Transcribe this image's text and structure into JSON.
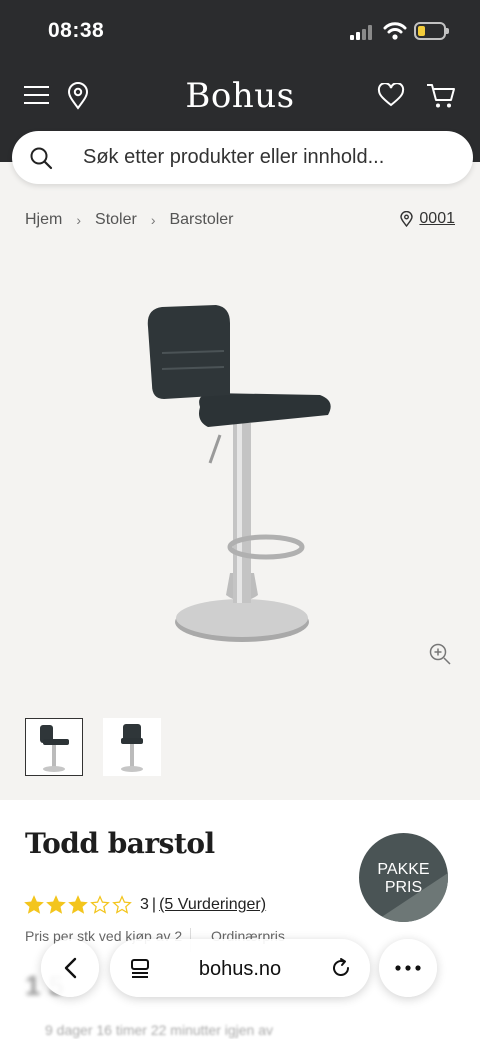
{
  "status": {
    "time": "08:38"
  },
  "header": {
    "brand": "Bohus",
    "icons": [
      "menu-icon",
      "location-pin-icon",
      "heart-icon",
      "cart-icon"
    ]
  },
  "search": {
    "placeholder": "Søk etter produkter eller innhold..."
  },
  "breadcrumb": [
    "Hjem",
    "Stoler",
    "Barstoler"
  ],
  "store": {
    "code": "0001"
  },
  "product": {
    "title": "Todd barstol",
    "badge": "PAKKE\nPRIS",
    "rating": {
      "stars": 3,
      "max": 5,
      "count": "3",
      "separator": "|",
      "reviews_link": "(5 Vurderinger)"
    },
    "price_label": "Pris per stk ved kjøp av 2",
    "ordinary_label": "Ordinærpris",
    "price": "1 5",
    "timer": "9 dager 16 timer 22 minutter igjen av"
  },
  "browser": {
    "url": "bohus.no"
  },
  "colors": {
    "header_bg": "#2b2c2e",
    "star": "#f3c51d",
    "page_bg": "#f4f3f1",
    "badge": "#4a5455"
  }
}
